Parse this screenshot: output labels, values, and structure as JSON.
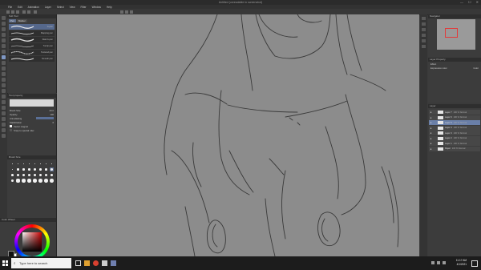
{
  "window": {
    "title": "Untitled (unreadable in screenshot)",
    "controls": [
      "—",
      "☐",
      "✕"
    ]
  },
  "menu": {
    "items": [
      "File",
      "Edit",
      "Animation",
      "Layer",
      "Select",
      "View",
      "Filter",
      "Window",
      "Help"
    ]
  },
  "sub_tool": {
    "title": "Sub Tool",
    "tabs": [
      "Pen",
      "Marker"
    ],
    "brushes": [
      {
        "label": "G-pen",
        "selected": true
      },
      {
        "label": "Mapping pen",
        "selected": false
      },
      {
        "label": "Real G-pen",
        "selected": false
      },
      {
        "label": "Turnip pen",
        "selected": false
      },
      {
        "label": "Textured pen",
        "selected": false
      },
      {
        "label": "Smooth pen",
        "selected": false
      }
    ]
  },
  "tool_property": {
    "title": "Tool property",
    "tool_name": "G-pen",
    "rows": [
      {
        "label": "Brush Size",
        "value": "20.0"
      },
      {
        "label": "Opacity",
        "value": "100"
      },
      {
        "label": "Anti-aliasing",
        "value": ""
      },
      {
        "label": "Stabilization",
        "value": "6"
      }
    ],
    "checkboxes": [
      {
        "label": "Vector magnet",
        "checked": true
      },
      {
        "label": "Snap to special ruler",
        "checked": false
      }
    ]
  },
  "brush_size": {
    "title": "Brush Size",
    "sizes": [
      0.7,
      1,
      1.5,
      2,
      2.5,
      3,
      4,
      5,
      6,
      7,
      8,
      10,
      12,
      15,
      17,
      20,
      25,
      30,
      40,
      50,
      60,
      70,
      80,
      100,
      120,
      150,
      170,
      200,
      250,
      300,
      400,
      500
    ],
    "selected_index": 15
  },
  "color": {
    "title": "Color Wheel",
    "main_color": "#111111",
    "sub_color": "#ffffff"
  },
  "navigator": {
    "title": "Navigator"
  },
  "layer_property": {
    "title": "Layer Property",
    "effect_label": "Effect",
    "expression_label": "Expression color",
    "expression_value": "Color"
  },
  "layers": {
    "title": "Layer",
    "items": [
      {
        "name": "100 % Normal",
        "sub": "Layer 7",
        "visible": true,
        "selected": false
      },
      {
        "name": "100 % Normal",
        "sub": "Layer 6",
        "visible": true,
        "selected": false
      },
      {
        "name": "100 % Normal",
        "sub": "Layer 5",
        "visible": true,
        "selected": true
      },
      {
        "name": "100 % Normal",
        "sub": "Layer 4",
        "visible": true,
        "selected": false
      },
      {
        "name": "100 % Normal",
        "sub": "Layer 3",
        "visible": true,
        "selected": false
      },
      {
        "name": "100 % Normal",
        "sub": "Layer 2",
        "visible": true,
        "selected": false
      },
      {
        "name": "100 % Normal",
        "sub": "Layer 1",
        "visible": true,
        "selected": false
      },
      {
        "name": "100 % Normal",
        "sub": "Paper",
        "visible": true,
        "selected": false
      }
    ]
  },
  "taskbar": {
    "search_placeholder": "Type here to search",
    "time": "11:17 AM",
    "date": "4/1/2021"
  }
}
